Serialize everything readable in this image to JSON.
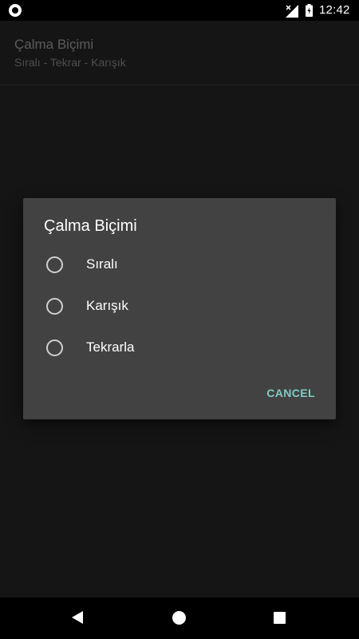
{
  "status_bar": {
    "time": "12:42",
    "icons": [
      "app-notification-icon",
      "signal-no-data-icon",
      "battery-charging-icon"
    ]
  },
  "preference": {
    "title": "Çalma Biçimi",
    "summary": "Sıralı - Tekrar - Karışık"
  },
  "dialog": {
    "title": "Çalma Biçimi",
    "options": [
      {
        "label": "Sıralı",
        "selected": false
      },
      {
        "label": "Karışık",
        "selected": false
      },
      {
        "label": "Tekrarla",
        "selected": false
      }
    ],
    "cancel_label": "CANCEL",
    "accent_color": "#80cbc4"
  },
  "nav_bar": {
    "icons": [
      "back-icon",
      "home-icon",
      "recents-icon"
    ]
  }
}
